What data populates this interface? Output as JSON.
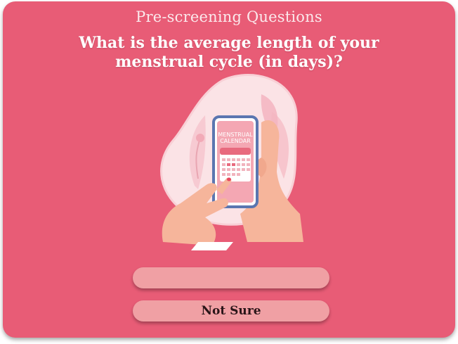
{
  "header": {
    "title": "Pre-screening Questions"
  },
  "question": {
    "text": "What is the average length of your menstrual cycle (in days)?"
  },
  "illustration": {
    "calendar_label_line1": "MENSTRUAL",
    "calendar_label_line2": "CALENDAR",
    "icon": "phone-calendar-illustration"
  },
  "answer_input": {
    "value": "",
    "placeholder": ""
  },
  "buttons": {
    "not_sure_label": "Not Sure"
  },
  "colors": {
    "background": "#e85c76",
    "pill": "#f0a0a4",
    "blob": "#fbe3e6",
    "skin": "#f6b59b",
    "phone_frame": "#5b76b0"
  }
}
